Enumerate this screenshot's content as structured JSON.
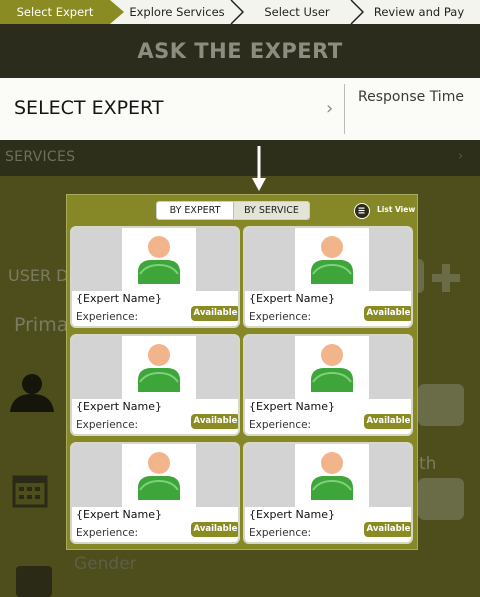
{
  "steps": [
    "Select Expert",
    "Explore  Services",
    "Select User",
    "Review and Pay"
  ],
  "header": {
    "title": "ASK THE EXPERT"
  },
  "select_row": {
    "label": "SELECT EXPERT",
    "chevron": "›",
    "right_label": "Response Time"
  },
  "services_row": {
    "label": "SERVICES",
    "chevron": "›"
  },
  "background": {
    "user_label": "USER D",
    "primary_label": "Prima",
    "th_fragment": "th",
    "gender_label": "Gender"
  },
  "modal": {
    "tabs": [
      "BY EXPERT",
      "BY SERVICE"
    ],
    "active_tab": "BY EXPERT",
    "list_view_label": "List View",
    "cards": [
      {
        "name": "{Expert Name}",
        "experience": "Experience:",
        "status": "Available"
      },
      {
        "name": "{Expert Name}",
        "experience": "Experience:",
        "status": "Available"
      },
      {
        "name": "{Expert Name}",
        "experience": "Experience:",
        "status": "Available"
      },
      {
        "name": "{Expert Name}",
        "experience": "Experience:",
        "status": "Available"
      },
      {
        "name": "{Expert Name}",
        "experience": "Experience:",
        "status": "Available"
      },
      {
        "name": "{Expert Name}",
        "experience": "Experience:",
        "status": "Available"
      }
    ]
  },
  "icons": [
    "step-arrow-icon",
    "chevron-right-icon",
    "down-arrow-icon",
    "list-view-icon",
    "user-avatar-icon",
    "person-icon",
    "calendar-icon",
    "plus-icon"
  ],
  "colors": {
    "accent": "#8a8b22",
    "modal": "#868726",
    "header_bg": "#2b2c1b"
  }
}
